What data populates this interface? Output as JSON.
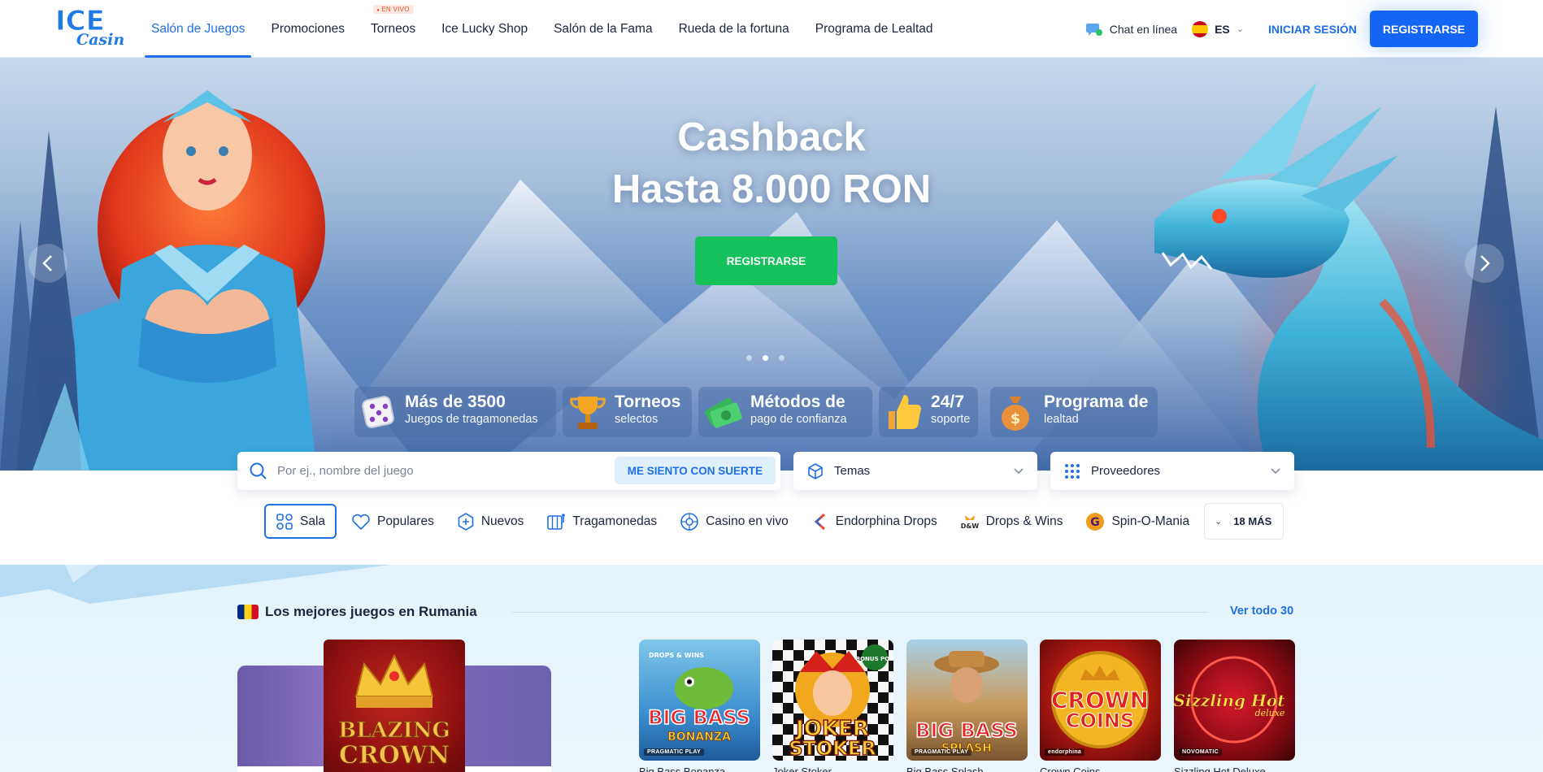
{
  "header": {
    "logo": {
      "line1": "ICE",
      "line2": "Casino"
    },
    "nav": [
      {
        "label": "Salón de Juegos",
        "active": true
      },
      {
        "label": "Promociones"
      },
      {
        "label": "Torneos",
        "badge": "EN VIVO"
      },
      {
        "label": "Ice Lucky Shop"
      },
      {
        "label": "Salón de la Fama"
      },
      {
        "label": "Rueda de la fortuna"
      },
      {
        "label": "Programa de Lealtad"
      }
    ],
    "chat_label": "Chat en línea",
    "language": "ES",
    "login_label": "INICIAR SESIÓN",
    "register_label": "REGISTRARSE"
  },
  "hero": {
    "title_line1": "Cashback",
    "title_line2": "Hasta 8.000 RON",
    "cta_label": "REGISTRARSE",
    "slides_total": 3,
    "slide_active": 2,
    "features": [
      {
        "icon": "dice-icon",
        "title": "Más de 3500",
        "subtitle": "Juegos de tragamonedas"
      },
      {
        "icon": "trophy-icon",
        "title": "Torneos",
        "subtitle": "selectos"
      },
      {
        "icon": "money-icon",
        "title": "Métodos de",
        "subtitle": "pago de confianza"
      },
      {
        "icon": "thumbs-up-icon",
        "title": "24/7",
        "subtitle": "soporte"
      },
      {
        "icon": "money-bag-icon",
        "title": "Programa de",
        "subtitle": "lealtad"
      }
    ]
  },
  "search": {
    "placeholder": "Por ej., nombre del juego",
    "lucky_label": "ME SIENTO CON SUERTE",
    "themes_label": "Temas",
    "providers_label": "Proveedores"
  },
  "categories": [
    {
      "label": "Sala",
      "icon": "grid-icon",
      "active": true
    },
    {
      "label": "Populares",
      "icon": "heart-icon"
    },
    {
      "label": "Nuevos",
      "icon": "plus-icon"
    },
    {
      "label": "Tragamonedas",
      "icon": "slot-icon"
    },
    {
      "label": "Casino en vivo",
      "icon": "roulette-icon"
    },
    {
      "label": "Endorphina Drops",
      "icon": "endorphina-icon"
    },
    {
      "label": "Drops & Wins",
      "icon": "drops-wins-icon"
    },
    {
      "label": "Spin-O-Mania",
      "icon": "spin-o-mania-icon"
    }
  ],
  "more_label": "18 MÁS",
  "section": {
    "title": "Los mejores juegos en Rumania",
    "see_all": "Ver todo 30",
    "featured": {
      "art_line1": "BLAZING",
      "art_line2": "CROWN"
    },
    "games": [
      {
        "name": "Big Bass Bonanza",
        "art_line1": "BIG BASS",
        "art_line2": "BONANZA",
        "brand": "PRAGMATIC PLAY",
        "tag": "DROPS & WINS"
      },
      {
        "name": "Joker Stoker",
        "art_line1": "JOKER",
        "art_line2": "STOKER",
        "tag": "BONUS POP"
      },
      {
        "name": "Big Bass Splash",
        "art_line1": "BIG BASS",
        "art_line2": "SPLASH",
        "brand": "PRAGMATIC PLAY"
      },
      {
        "name": "Crown Coins",
        "art_line1": "CROWN",
        "art_line2": "COINS",
        "brand": "endorphina"
      },
      {
        "name": "Sizzling Hot Deluxe",
        "art_line1": "Sizzling Hot",
        "art_line2": "deluxe",
        "brand": "NOVOMATIC"
      }
    ]
  }
}
